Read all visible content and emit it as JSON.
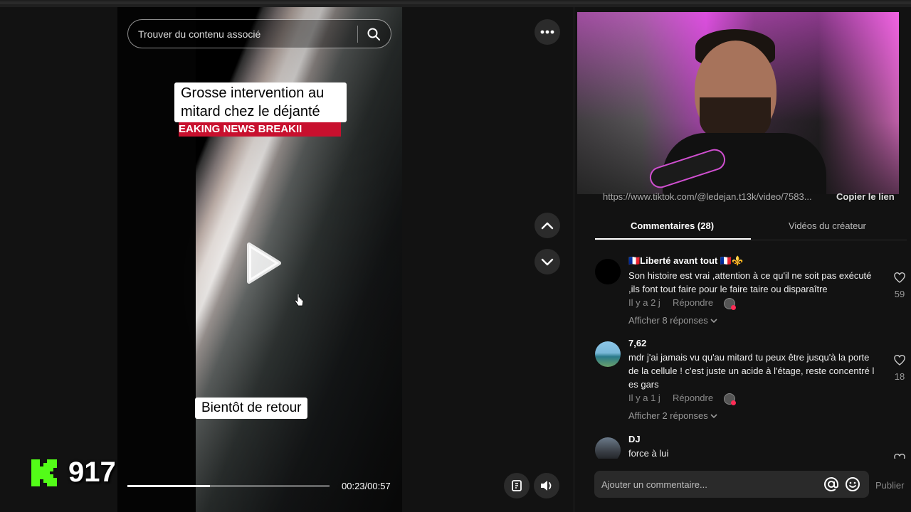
{
  "video": {
    "search_placeholder": "Trouver du contenu associé",
    "caption_top": "Grosse intervention au mitard chez le déjanté",
    "breaking_banner": "EAKING NEWS   BREAKII",
    "caption_bottom": "Bientôt de retour",
    "time": "00:23/00:57",
    "progress": 0.41,
    "overlay_counter": "917"
  },
  "panel": {
    "link_url": "https://www.tiktok.com/@ledejan.t13k/video/7583...",
    "copy_link": "Copier le lien",
    "tabs": [
      {
        "label": "Commentaires (28)",
        "active": true
      },
      {
        "label": "Vidéos du créateur",
        "active": false
      }
    ],
    "comments": [
      {
        "user": "🇫🇷Liberté avant tout 🇫🇷⚜️",
        "text": "Son histoire est vrai ,attention à ce qu'il ne soit pas exécuté ,ils font tout faire pour le faire taire ou disparaître",
        "date": "Il y a 2 j",
        "reply": "Répondre",
        "replies": "Afficher 8 réponses",
        "likes": "59"
      },
      {
        "user": "7,62",
        "text": "mdr j'ai jamais vu qu'au mitard tu peux être jusqu'à la porte de la cellule ! c'est juste un acide à l'étage, reste concentré l es gars",
        "date": "Il y a 1 j",
        "reply": "Répondre",
        "replies": "Afficher 2 réponses",
        "likes": "18"
      },
      {
        "user": "DJ",
        "text": "force à lui",
        "likes": ""
      }
    ],
    "comment_placeholder": "Ajouter un commentaire...",
    "publish": "Publier"
  },
  "icons": [
    "search-icon",
    "play-icon",
    "more-icon",
    "chevron-up-icon",
    "chevron-down-icon",
    "caption-icon",
    "volume-icon",
    "heart-icon",
    "at-icon",
    "emoji-icon",
    "chevron-down-small-icon"
  ],
  "colors": {
    "accent_red": "#fe2c55",
    "banner_red": "#c8102e",
    "kick_green": "#53fc18"
  }
}
